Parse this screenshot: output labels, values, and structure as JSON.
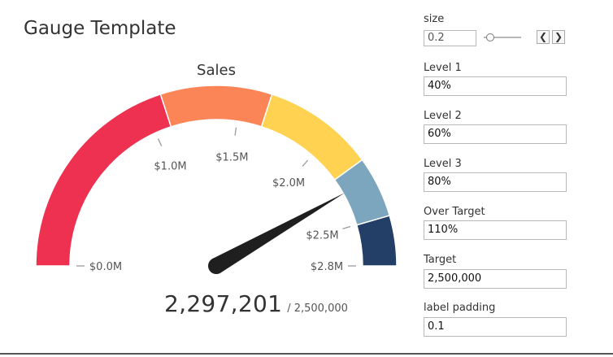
{
  "dashboard": {
    "title": "Gauge Template"
  },
  "gauge": {
    "title": "Sales",
    "value_text": "2,297,201",
    "target_text": "/ 2,500,000",
    "value": 2297201,
    "target": 2500000,
    "max": 2750000,
    "bands": [
      {
        "from": 0,
        "to": 0.4,
        "color": "#ee3150"
      },
      {
        "from": 0.4,
        "to": 0.6,
        "color": "#fb8556"
      },
      {
        "from": 0.6,
        "to": 0.8,
        "color": "#ffd351"
      },
      {
        "from": 0.8,
        "to": 0.91,
        "color": "#7ca6bd"
      },
      {
        "from": 0.91,
        "to": 1.0,
        "color": "#243f67"
      }
    ],
    "needle_color": "#1f1f1f",
    "tick_color": "#9a9a9a",
    "labels": [
      {
        "text": "$0.0M",
        "value": 0
      },
      {
        "text": "$1.0M",
        "value": 1000000
      },
      {
        "text": "$1.5M",
        "value": 1500000
      },
      {
        "text": "$2.0M",
        "value": 2000000
      },
      {
        "text": "$2.5M",
        "value": 2500000
      },
      {
        "text": "$2.8M",
        "value": 2750000
      }
    ]
  },
  "params": {
    "size": {
      "label": "size",
      "value": "0.2",
      "slider_fraction": 0.1
    },
    "level1": {
      "label": "Level 1",
      "value": "40%"
    },
    "level2": {
      "label": "Level 2",
      "value": "60%"
    },
    "level3": {
      "label": "Level 3",
      "value": "80%"
    },
    "over_target": {
      "label": "Over Target",
      "value": "110%"
    },
    "target": {
      "label": "Target",
      "value": "2,500,000"
    },
    "label_padding": {
      "label": "label padding",
      "value": "0.1"
    }
  },
  "controls": {
    "prev": "❮",
    "next": "❯"
  }
}
